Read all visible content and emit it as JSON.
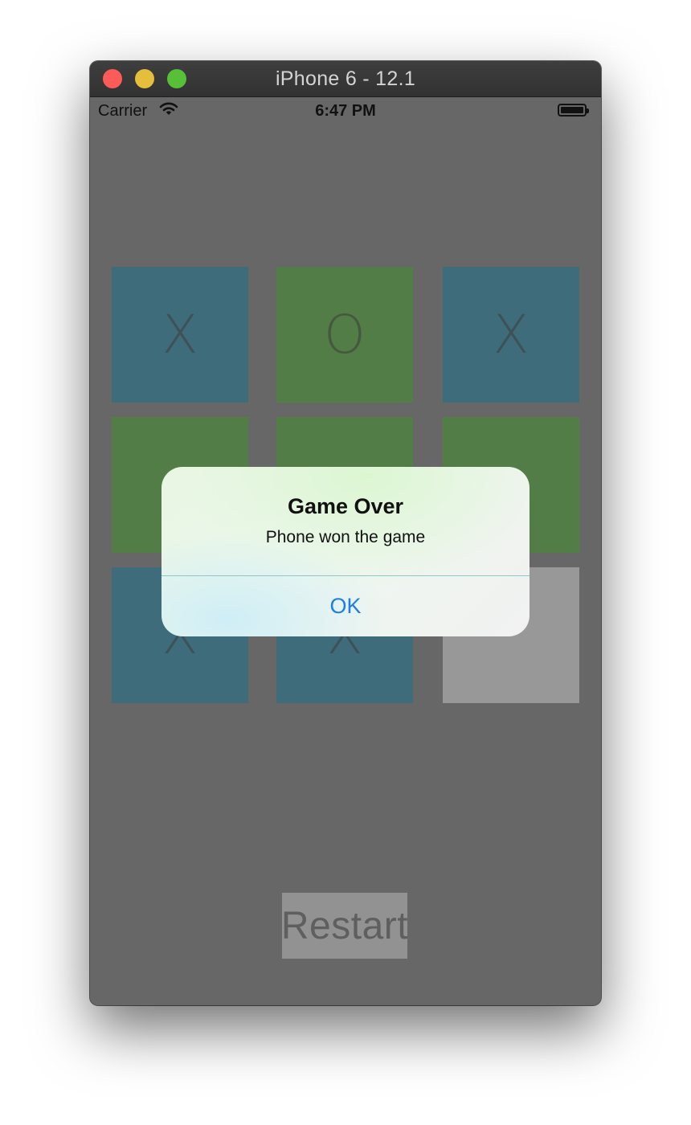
{
  "window": {
    "title": "iPhone 6 - 12.1"
  },
  "status_bar": {
    "carrier": "Carrier",
    "time": "6:47 PM"
  },
  "board": [
    {
      "mark": "X",
      "color": "blue"
    },
    {
      "mark": "O",
      "color": "green"
    },
    {
      "mark": "X",
      "color": "blue"
    },
    {
      "mark": "",
      "color": "green"
    },
    {
      "mark": "",
      "color": "green"
    },
    {
      "mark": "",
      "color": "green"
    },
    {
      "mark": "X",
      "color": "blue"
    },
    {
      "mark": "X",
      "color": "blue"
    },
    {
      "mark": "",
      "color": "grey"
    }
  ],
  "restart_label": "Restart",
  "alert": {
    "title": "Game Over",
    "message": "Phone won the game",
    "ok_label": "OK"
  },
  "colors": {
    "blue_cell": "#3f6c7b",
    "green_cell": "#527d46",
    "empty_cell": "#989898",
    "dim_background": "#676767",
    "ok_blue": "#1b7fe3"
  }
}
